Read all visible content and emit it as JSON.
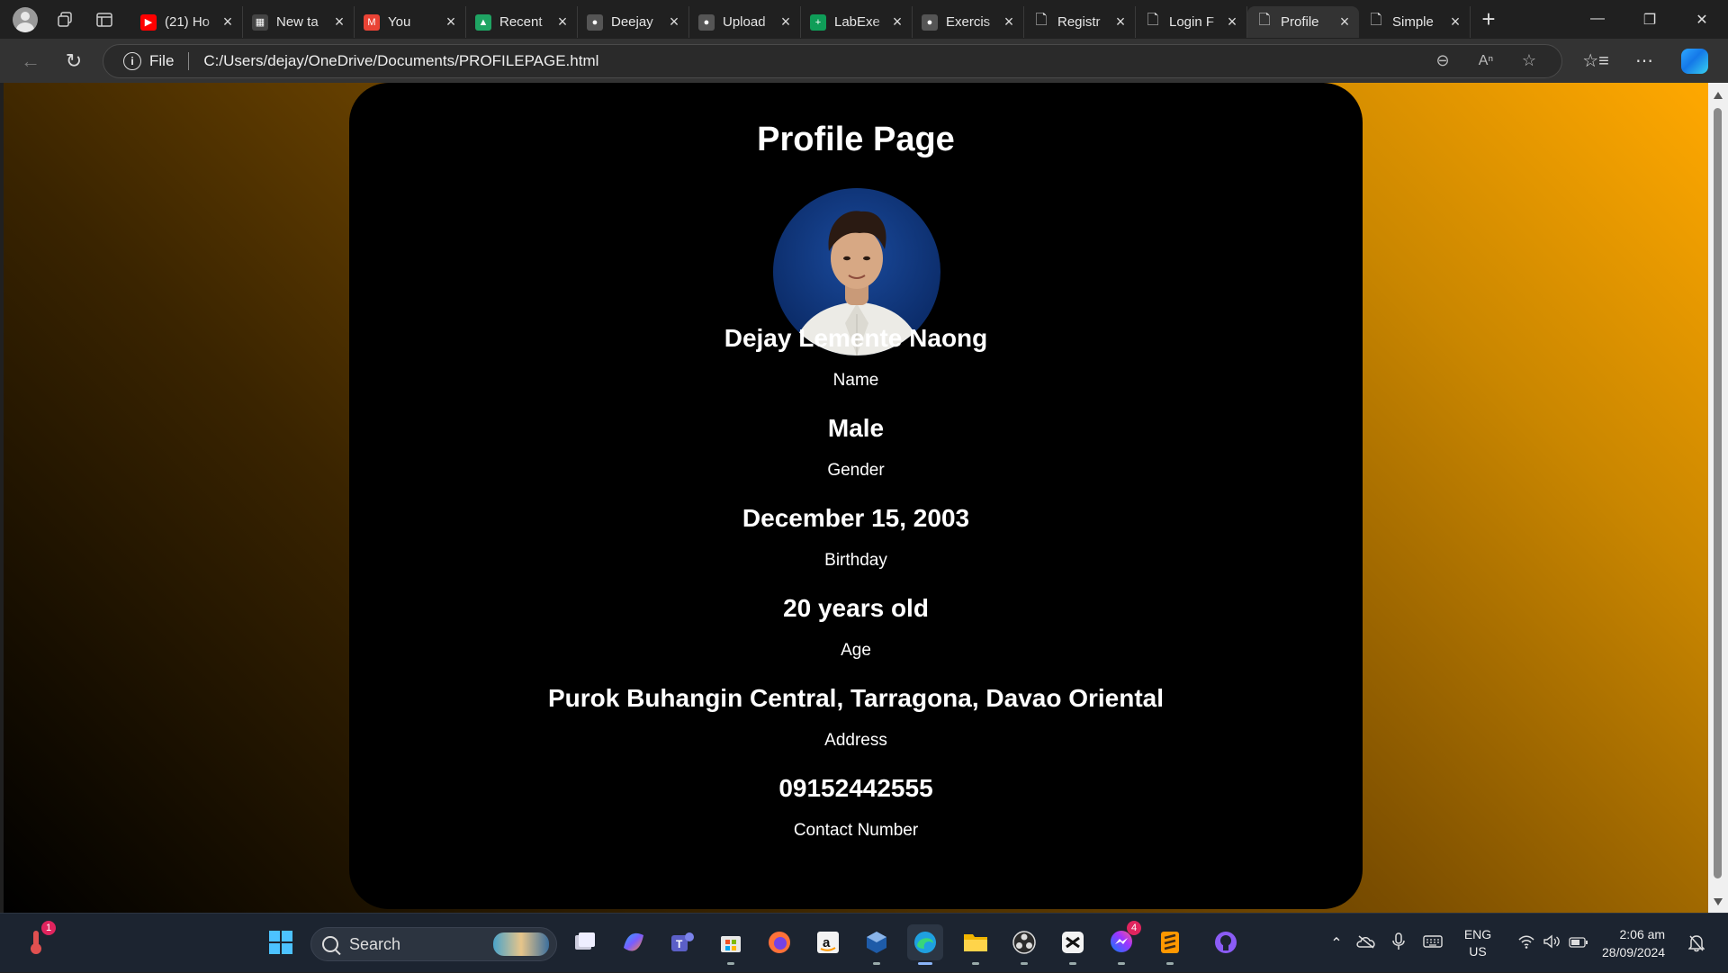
{
  "browser": {
    "tabs": [
      {
        "title": "(21) Ho",
        "favicon": "youtube-icon",
        "color": "#ff0000",
        "glyph": "▶"
      },
      {
        "title": "New ta",
        "favicon": "newtab-icon",
        "color": "#444444",
        "glyph": "▦"
      },
      {
        "title": "You",
        "favicon": "gmail-icon",
        "color": "#ea4335",
        "glyph": "M"
      },
      {
        "title": "Recent",
        "favicon": "drive-icon",
        "color": "#1fa463",
        "glyph": "▲"
      },
      {
        "title": "Deejay",
        "favicon": "github-icon",
        "color": "#555555",
        "glyph": "●"
      },
      {
        "title": "Upload",
        "favicon": "github-icon",
        "color": "#555555",
        "glyph": "●"
      },
      {
        "title": "LabExe",
        "favicon": "sheets-icon",
        "color": "#0f9d58",
        "glyph": "+"
      },
      {
        "title": "Exercis",
        "favicon": "github-icon",
        "color": "#555555",
        "glyph": "●"
      },
      {
        "title": "Registr",
        "favicon": "file-icon",
        "color": "transparent",
        "glyph": "🗋"
      },
      {
        "title": "Login F",
        "favicon": "file-icon",
        "color": "transparent",
        "glyph": "🗋"
      },
      {
        "title": "Profile",
        "favicon": "file-icon",
        "color": "transparent",
        "glyph": "🗋",
        "active": true
      },
      {
        "title": "Simple",
        "favicon": "file-icon",
        "color": "transparent",
        "glyph": "🗋"
      }
    ],
    "scheme_label": "File",
    "url": "C:/Users/dejay/OneDrive/Documents/PROFILEPAGE.html"
  },
  "page": {
    "heading": "Profile Page",
    "fields": [
      {
        "value": "Dejay Lemente Naong",
        "label": "Name"
      },
      {
        "value": "Male",
        "label": "Gender"
      },
      {
        "value": "December 15, 2003",
        "label": "Birthday"
      },
      {
        "value": "20 years old",
        "label": "Age"
      },
      {
        "value": "Purok Buhangin Central, Tarragona, Davao Oriental",
        "label": "Address"
      },
      {
        "value": "09152442555",
        "label": "Contact Number"
      }
    ],
    "background_gradient": [
      "#000000",
      "#ffa800"
    ]
  },
  "taskbar": {
    "search_placeholder": "Search",
    "weather_badge": "1",
    "messenger_badge": "4",
    "language": "ENG",
    "region": "US",
    "time": "2:06 am",
    "date": "28/09/2024"
  }
}
